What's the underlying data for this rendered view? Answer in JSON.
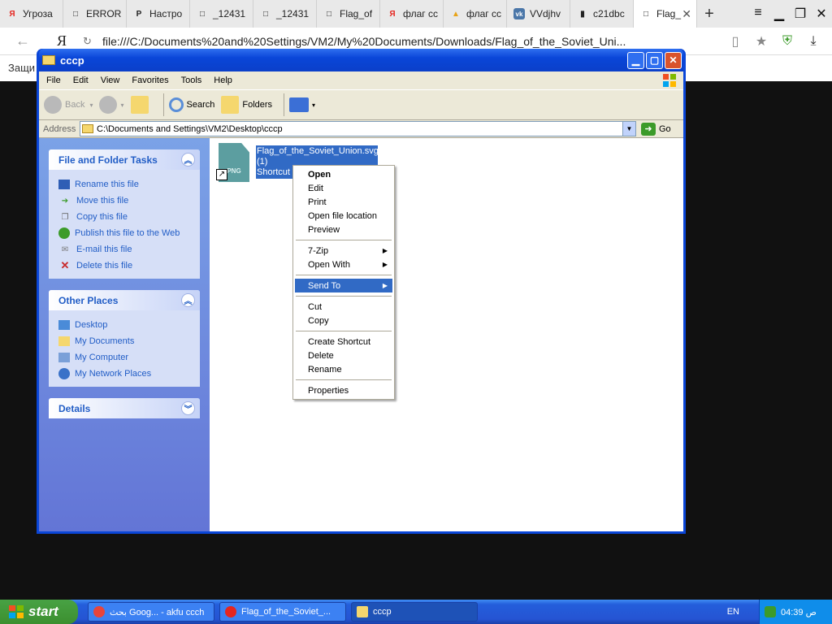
{
  "browser": {
    "tabs": [
      {
        "label": "Угроза",
        "icon": "Я",
        "icon_color": "#e52620"
      },
      {
        "label": "ERROR",
        "icon": "□",
        "icon_color": "#555555"
      },
      {
        "label": "Настро",
        "icon": "P",
        "icon_color": "#222222"
      },
      {
        "label": "_12431",
        "icon": "□",
        "icon_color": "#555555"
      },
      {
        "label": "_12431",
        "icon": "□",
        "icon_color": "#555555"
      },
      {
        "label": "Flag_of",
        "icon": "□",
        "icon_color": "#555555"
      },
      {
        "label": "флаг сс",
        "icon": "Я",
        "icon_color": "#e52620"
      },
      {
        "label": "флаг сс",
        "icon": "▲",
        "icon_color": "#e8a317"
      },
      {
        "label": "VVdjhv",
        "icon": "vk",
        "icon_color": "#4a76a8"
      },
      {
        "label": "c21dbc",
        "icon": "▮",
        "icon_color": "#222222"
      },
      {
        "label": "Flag_",
        "icon": "□",
        "icon_color": "#555555",
        "active": true
      }
    ],
    "url": "file:///C:/Documents%20and%20Settings/VM2/My%20Documents/Downloads/Flag_of_the_Soviet_Uni...",
    "yandex_logo": "Я",
    "protect_label": "Защи"
  },
  "window": {
    "title": "cccp",
    "menu": [
      "File",
      "Edit",
      "View",
      "Favorites",
      "Tools",
      "Help"
    ],
    "toolbar": {
      "back": "Back",
      "search": "Search",
      "folders": "Folders"
    },
    "address_label": "Address",
    "address": "C:\\Documents and Settings\\VM2\\Desktop\\cccp",
    "go": "Go"
  },
  "taskpane": {
    "file_tasks": {
      "title": "File and Folder Tasks",
      "items": [
        "Rename this file",
        "Move this file",
        "Copy this file",
        "Publish this file to the Web",
        "E-mail this file",
        "Delete this file"
      ]
    },
    "other_places": {
      "title": "Other Places",
      "items": [
        "Desktop",
        "My Documents",
        "My Computer",
        "My Network Places"
      ]
    },
    "details": {
      "title": "Details"
    }
  },
  "file": {
    "name_line1": "Flag_of_the_Soviet_Union.svg",
    "name_line2": "(1)",
    "name_line3": "Shortcut",
    "icon_text": "PNG"
  },
  "context_menu": {
    "group1": [
      "Open",
      "Edit",
      "Print",
      "Open file location",
      "Preview"
    ],
    "group2": [
      "7-Zip",
      "Open With"
    ],
    "group3": [
      "Send To"
    ],
    "group4": [
      "Cut",
      "Copy"
    ],
    "group5": [
      "Create Shortcut",
      "Delete",
      "Rename"
    ],
    "group6": [
      "Properties"
    ]
  },
  "taskbar": {
    "start": "start",
    "tasks": [
      "بحث Goog... - akfu ccch",
      "Flag_of_the_Soviet_...",
      "cccp"
    ],
    "lang": "EN",
    "time": "04:39",
    "ampm": "ص"
  }
}
